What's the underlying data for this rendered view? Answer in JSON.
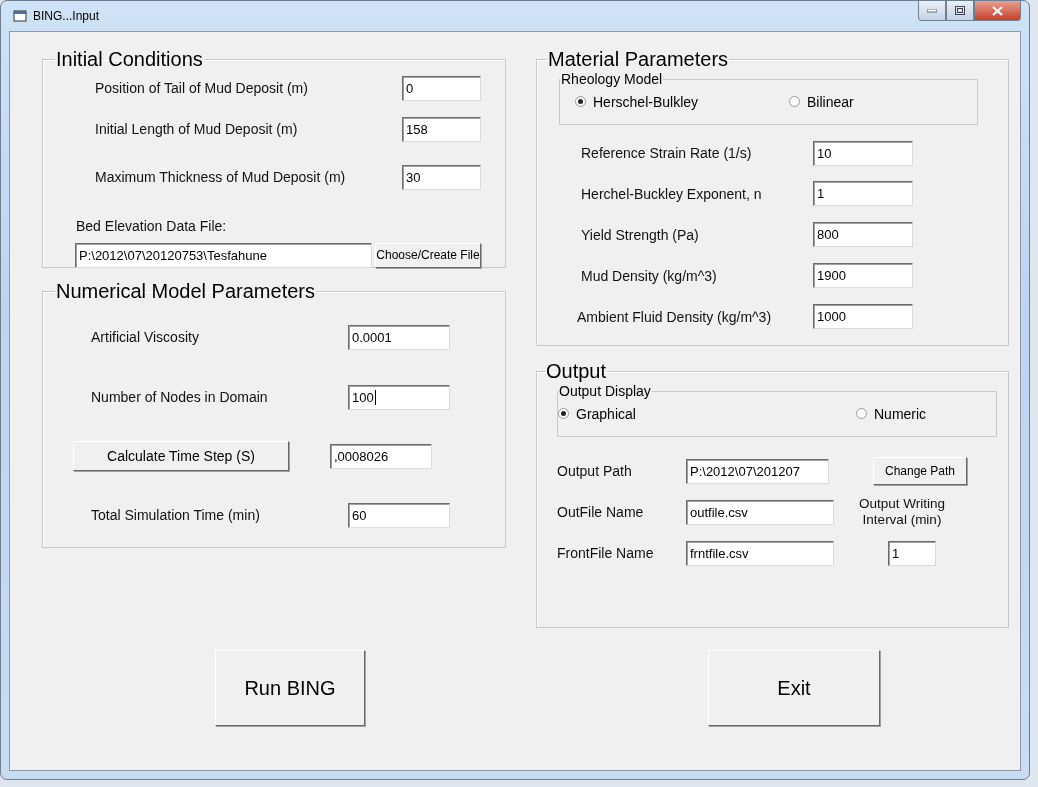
{
  "window": {
    "title": "BING...Input"
  },
  "initial_conditions": {
    "title": "Initial Conditions",
    "fields": [
      {
        "label": "Position of Tail of Mud Deposit (m)",
        "value": "0"
      },
      {
        "label": "Initial Length of Mud Deposit (m)",
        "value": "158"
      },
      {
        "label": "Maximum Thickness of Mud Deposit (m)",
        "value": "30"
      }
    ],
    "bed_file": {
      "label": "Bed Elevation Data File:",
      "value": "P:\\2012\\07\\20120753\\Tesfahune",
      "button": "Choose/Create File"
    }
  },
  "material_parameters": {
    "title": "Material Parameters",
    "rheology_model": {
      "title": "Rheology Model",
      "options": [
        {
          "label": "Herschel-Bulkley",
          "selected": true
        },
        {
          "label": "Bilinear",
          "selected": false
        }
      ]
    },
    "fields": [
      {
        "label": "Reference Strain Rate (1/s)",
        "value": "10"
      },
      {
        "label": "Herchel-Buckley Exponent, n",
        "value": "1"
      },
      {
        "label": "Yield Strength (Pa)",
        "value": "800"
      },
      {
        "label": "Mud Density (kg/m^3)",
        "value": "1900"
      },
      {
        "label": "Ambient Fluid Density (kg/m^3)",
        "value": "1000"
      }
    ]
  },
  "numerical_model_parameters": {
    "title": "Numerical Model Parameters",
    "rows": [
      {
        "kind": "label",
        "label": "Artificial Viscosity",
        "value": "0.0001",
        "focused": false
      },
      {
        "kind": "label",
        "label": "Number of Nodes in Domain",
        "value": "100",
        "focused": true
      },
      {
        "kind": "button",
        "label": "Calculate Time Step (S)",
        "value": ",0008026",
        "focused": false
      },
      {
        "kind": "label",
        "label": "Total Simulation Time (min)",
        "value": "60",
        "focused": false
      }
    ]
  },
  "output": {
    "title": "Output",
    "output_display": {
      "title": "Output Display",
      "options": [
        {
          "label": "Graphical",
          "selected": true
        },
        {
          "label": "Numeric",
          "selected": false
        }
      ]
    },
    "output_path": {
      "label": "Output Path",
      "value": "P:\\2012\\07\\201207",
      "button": "Change Path"
    },
    "outfile_name": {
      "label": "OutFile Name",
      "value": "outfile.csv"
    },
    "frontfile_name": {
      "label": "FrontFile Name",
      "value": "frntfile.csv"
    },
    "writing_interval": {
      "label": "Output Writing Interval (min)",
      "value": "1"
    }
  },
  "buttons": [
    "Run BING",
    "Exit"
  ]
}
